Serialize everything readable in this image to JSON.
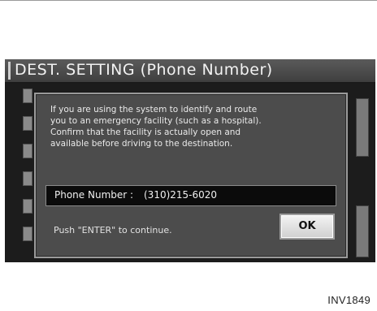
{
  "screen": {
    "title": "DEST. SETTING (Phone Number)"
  },
  "dialog": {
    "message_lines": [
      "If you are using the system to identify and route",
      "you to an emergency facility (such as a hospital).",
      "Confirm that the facility is actually open and",
      "available before driving to the destination."
    ],
    "phone_label": "Phone Number  :",
    "phone_value": "(310)215-6020",
    "instruction": "Push \"ENTER\" to continue.",
    "ok_label": "OK"
  },
  "figure": {
    "caption": "INV1849"
  }
}
